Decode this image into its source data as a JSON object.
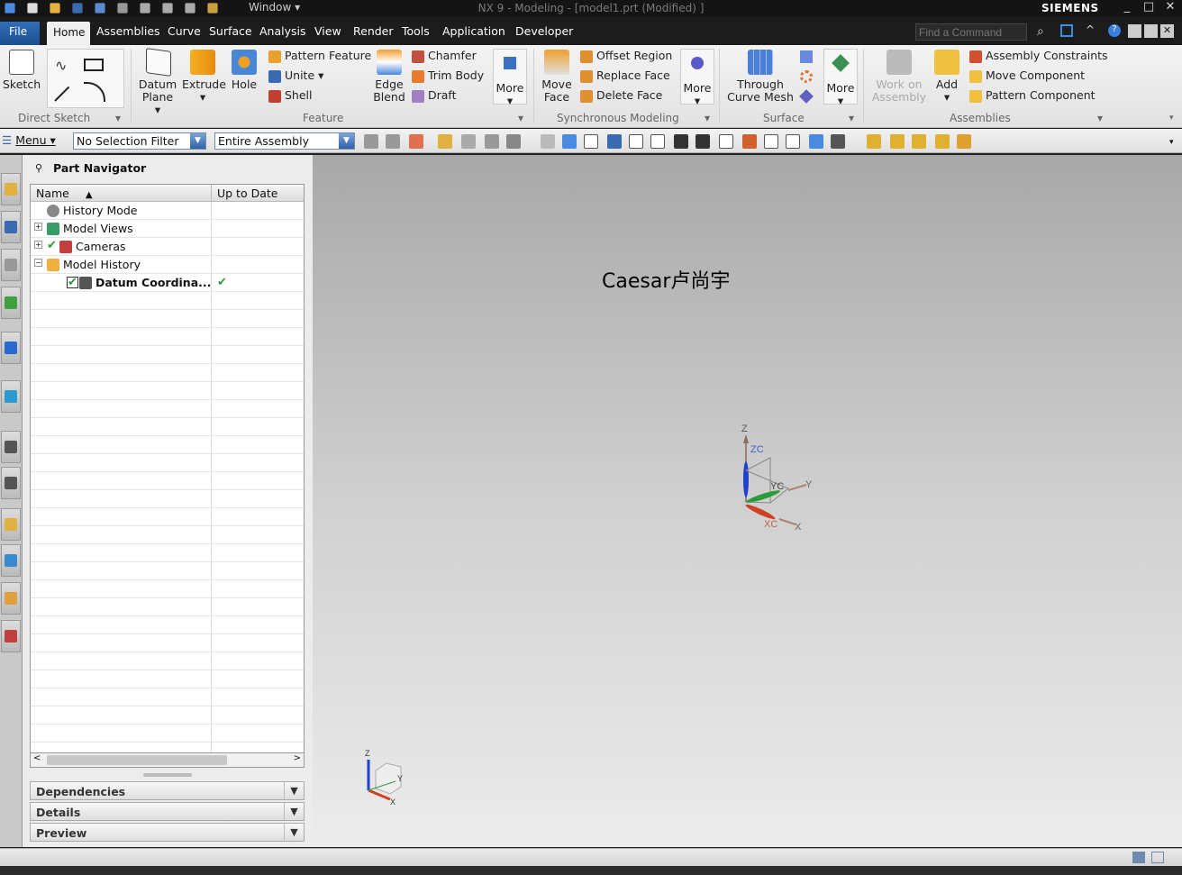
{
  "window": {
    "title": "NX 9 - Modeling - [model1.prt (Modified) ]",
    "brand": "SIEMENS",
    "window_menu": "Window ▾",
    "quick_access_icons": [
      "nx-logo-icon",
      "new-icon",
      "open-icon",
      "save-icon",
      "undo-icon",
      "redo-icon",
      "cut-icon",
      "copy-icon",
      "paste-icon",
      "touch-mode-icon"
    ]
  },
  "tabs": [
    "File",
    "Home",
    "Assemblies",
    "Curve",
    "Surface",
    "Analysis",
    "View",
    "Render",
    "Tools",
    "Application",
    "Developer"
  ],
  "active_tab": "Home",
  "search": {
    "placeholder": "Find a Command"
  },
  "ribbon": {
    "direct_sketch": {
      "label": "Direct Sketch",
      "sketch": "Sketch"
    },
    "feature": {
      "label": "Feature",
      "datum_plane": "Datum Plane ▾",
      "extrude": "Extrude",
      "hole": "Hole",
      "pattern_feature": "Pattern Feature",
      "unite": "Unite ▾",
      "shell": "Shell",
      "edge_blend": "Edge Blend",
      "chamfer": "Chamfer",
      "trim_body": "Trim Body",
      "draft": "Draft",
      "more": "More"
    },
    "sync": {
      "label": "Synchronous Modeling",
      "move_face": "Move Face",
      "offset_region": "Offset Region",
      "replace_face": "Replace Face",
      "delete_face": "Delete Face",
      "more": "More"
    },
    "surface": {
      "label": "Surface",
      "through_curve_mesh": "Through Curve Mesh",
      "more": "More"
    },
    "assemblies": {
      "label": "Assemblies",
      "work_on_assembly": "Work on Assembly",
      "add": "Add",
      "assembly_constraints": "Assembly Constraints",
      "move_component": "Move Component",
      "pattern_component": "Pattern Component"
    }
  },
  "toolbar": {
    "menu": "Menu ▾",
    "selection_filter": "No Selection Filter",
    "scope": "Entire Assembly"
  },
  "navigator": {
    "title": "Part Navigator",
    "columns": [
      "Name",
      "Up to Date"
    ],
    "rows": [
      {
        "name": "History Mode",
        "expander": "",
        "check": false,
        "up_to_date": ""
      },
      {
        "name": "Model Views",
        "expander": "+",
        "check": false,
        "up_to_date": ""
      },
      {
        "name": "Cameras",
        "expander": "+",
        "check": true,
        "up_to_date": ""
      },
      {
        "name": "Model History",
        "expander": "−",
        "check": false,
        "up_to_date": ""
      },
      {
        "name": "Datum Coordina...",
        "expander": "",
        "check": true,
        "up_to_date": "✔",
        "bold": true
      }
    ],
    "sections": [
      "Dependencies",
      "Details",
      "Preview"
    ]
  },
  "viewport": {
    "watermark": "Caesar卢尚宇",
    "axes": {
      "z": "Z",
      "zc": "ZC",
      "yc": "YC",
      "y": "Y",
      "xc": "XC",
      "x": "X"
    },
    "mini_axes": {
      "z": "Z",
      "y": "Y",
      "x": "X"
    }
  },
  "colors": {
    "accent": "#1c4f91",
    "x_axis": "#d04020",
    "y_axis": "#2a9a3a",
    "z_axis": "#1f3fd0"
  }
}
